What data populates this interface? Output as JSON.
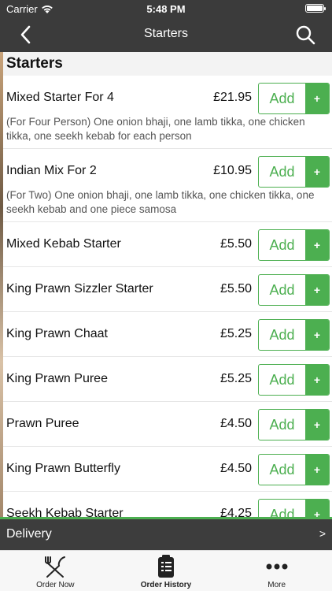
{
  "status_bar": {
    "carrier": "Carrier",
    "time": "5:48 PM"
  },
  "nav": {
    "title": "Starters"
  },
  "category": {
    "title": "Starters"
  },
  "add_label": "Add",
  "add_plus": "+",
  "items": [
    {
      "name": "Mixed Starter For 4",
      "price": "£21.95",
      "description": "(For Four Person) One onion bhaji, one lamb tikka, one chicken tikka, one seekh kebab for each person"
    },
    {
      "name": "Indian Mix For 2",
      "price": "£10.95",
      "description": "(For Two) One onion bhaji, one lamb tikka, one chicken tikka, one seekh kebab and one piece samosa"
    },
    {
      "name": "Mixed Kebab Starter",
      "price": "£5.50",
      "description": ""
    },
    {
      "name": "King Prawn Sizzler Starter",
      "price": "£5.50",
      "description": ""
    },
    {
      "name": "King Prawn Chaat",
      "price": "£5.25",
      "description": ""
    },
    {
      "name": "King Prawn Puree",
      "price": "£5.25",
      "description": ""
    },
    {
      "name": "Prawn Puree",
      "price": "£4.50",
      "description": ""
    },
    {
      "name": "King Prawn Butterfly",
      "price": "£4.50",
      "description": ""
    },
    {
      "name": "Seekh Kebab Starter",
      "price": "£4.25",
      "description": ""
    }
  ],
  "delivery": {
    "label": "Delivery",
    "arrow": ">"
  },
  "tabs": [
    {
      "label": "Order Now",
      "icon": "fork-knife-icon"
    },
    {
      "label": "Order History",
      "icon": "receipt-icon"
    },
    {
      "label": "More",
      "icon": "more-dots-icon"
    }
  ],
  "colors": {
    "accent": "#4caf50",
    "bar": "#3d3d3d"
  }
}
